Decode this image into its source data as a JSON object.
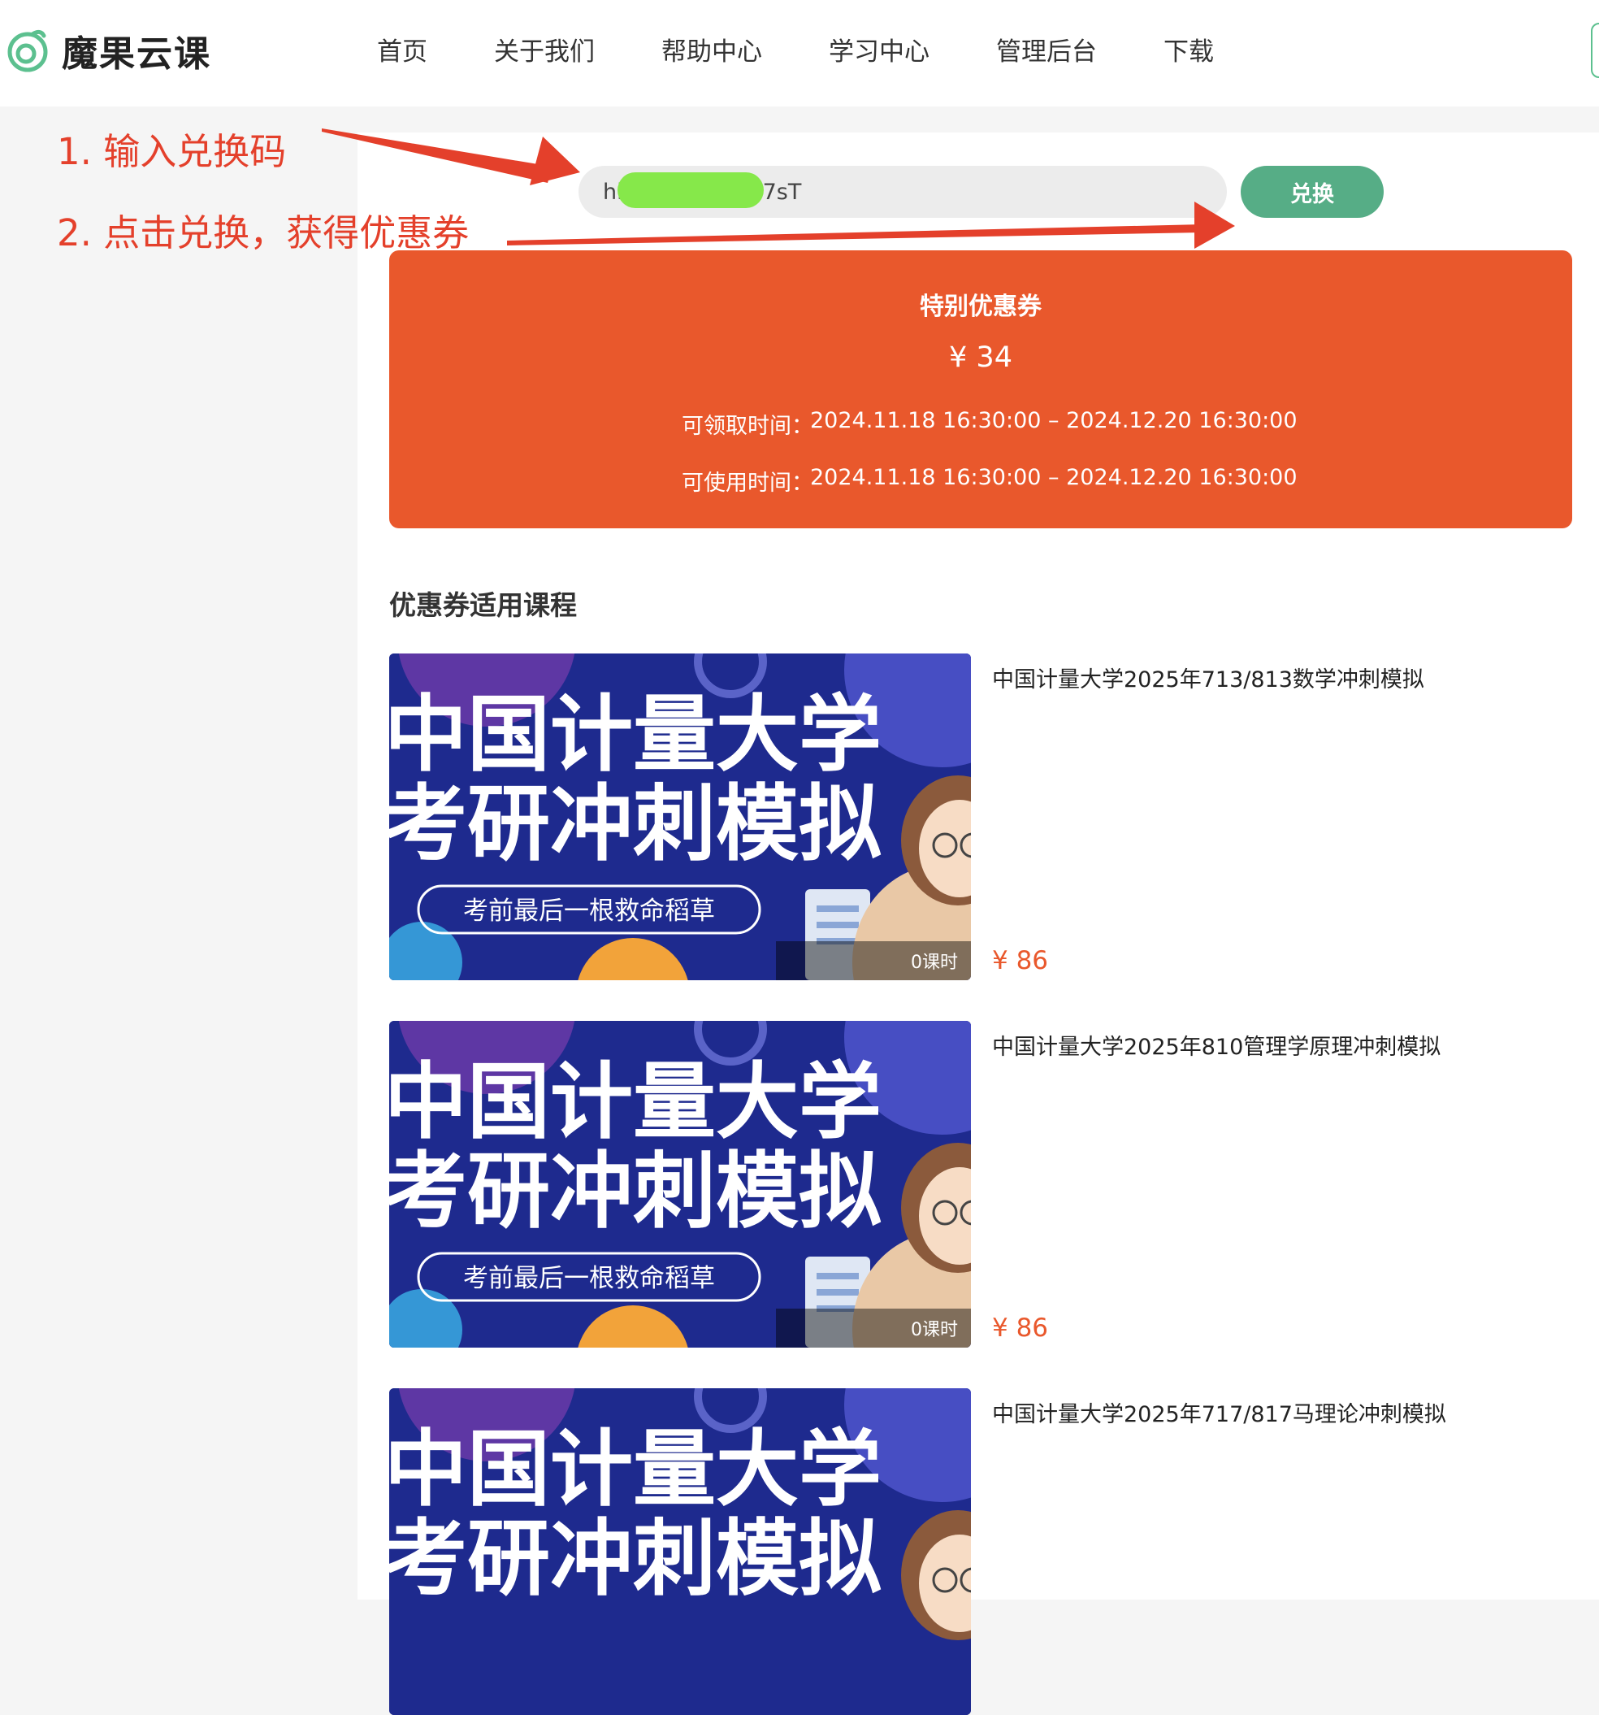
{
  "header": {
    "brand": "魔果云课",
    "nav": [
      "首页",
      "关于我们",
      "帮助中心",
      "学习中心",
      "管理后台",
      "下载"
    ]
  },
  "redeem": {
    "input_visible_prefix": "hl",
    "input_visible_suffix": "7sT",
    "button_label": "兑换"
  },
  "coupon": {
    "title": "特别优惠券",
    "amount": "¥ 34",
    "claim_label": "可领取时间：",
    "claim_time": "2024.11.18 16:30:00 – 2024.12.20 16:30:00",
    "use_label": "可使用时间：",
    "use_time": "2024.11.18 16:30:00 – 2024.12.20 16:30:00"
  },
  "courses_section": {
    "title": "优惠券适用课程",
    "thumbnail": {
      "line1": "中国计量大学",
      "line2": "考研冲刺模拟",
      "tagline": "考前最后一根救命稻草"
    },
    "items": [
      {
        "name": "中国计量大学2025年713/813数学冲刺模拟",
        "price": "¥ 86",
        "lessons": "0课时"
      },
      {
        "name": "中国计量大学2025年810管理学原理冲刺模拟",
        "price": "¥ 86",
        "lessons": "0课时"
      },
      {
        "name": "中国计量大学2025年717/817马理论冲刺模拟",
        "price": "",
        "lessons": ""
      }
    ]
  },
  "annotations": {
    "step1": "1. 输入兑换码",
    "step2": "2. 点击兑换，获得优惠券"
  },
  "colors": {
    "accent_green": "#56ad86",
    "coupon_orange": "#e9582c",
    "annotation_red": "#e4402b",
    "thumb_blue": "#1e2a8e"
  }
}
